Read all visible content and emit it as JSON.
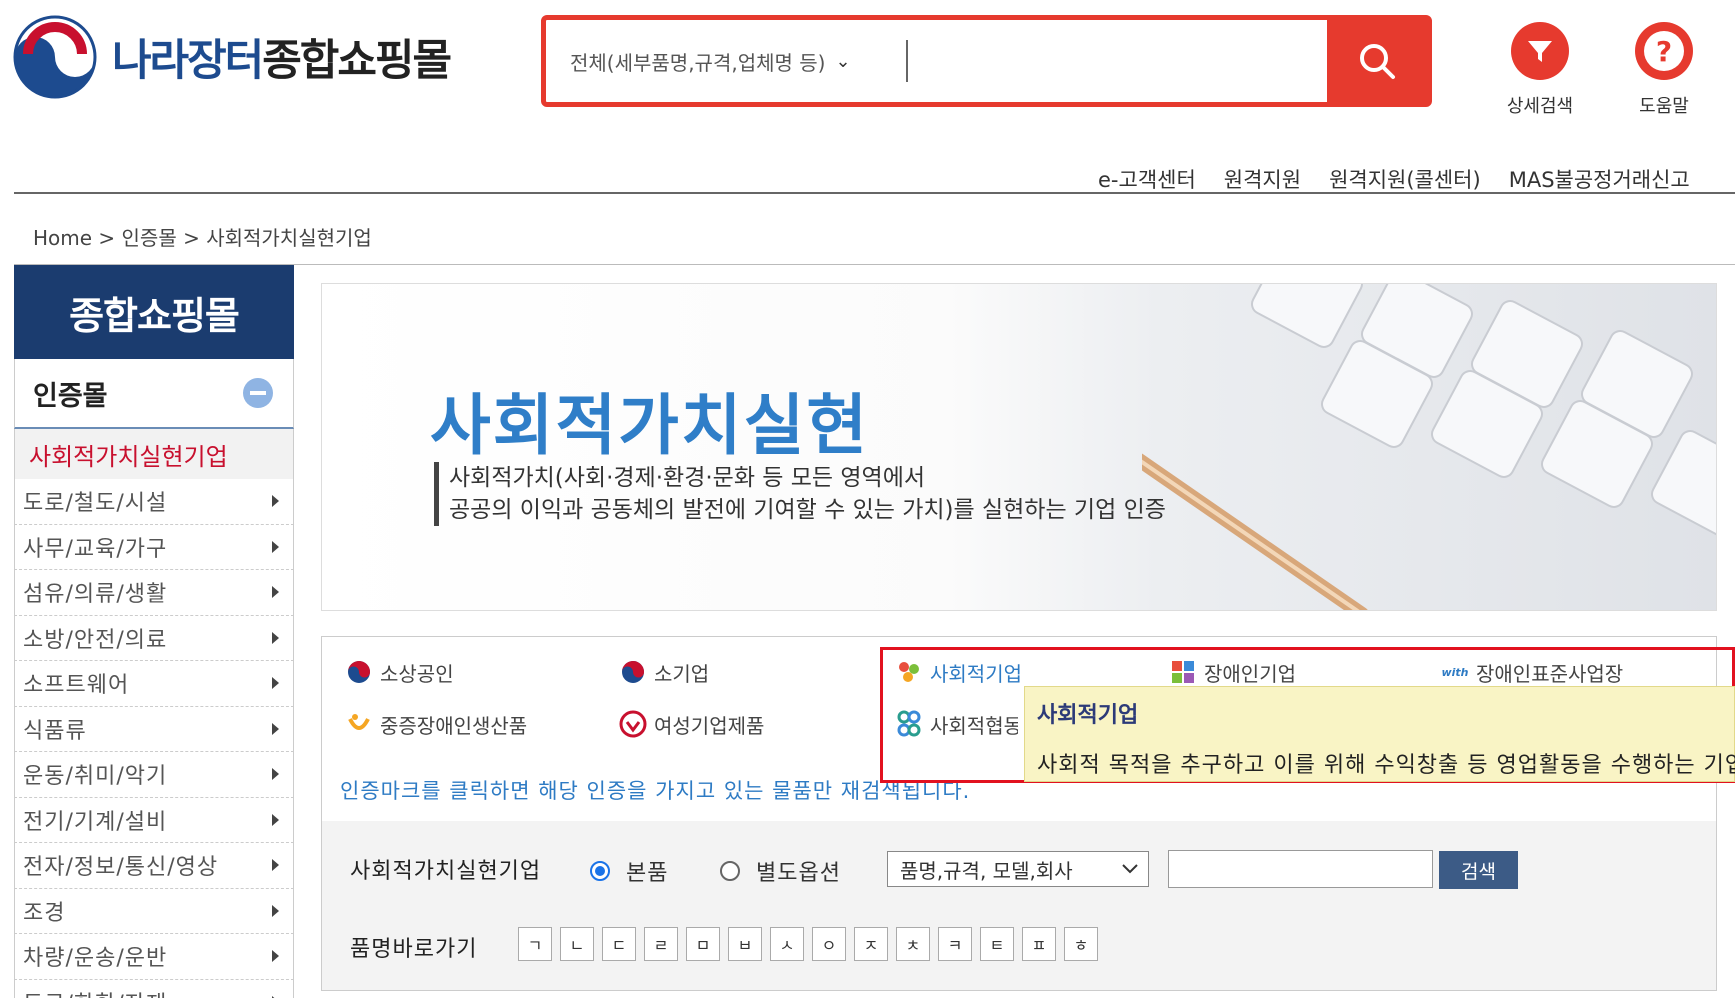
{
  "header": {
    "logo_blue": "나라장터",
    "logo_dark": "종합쇼핑몰",
    "search": {
      "scope": "전체(세부품명,규격,업체명 등)",
      "placeholder": ""
    },
    "tools": [
      {
        "label": "상세검색",
        "icon": "filter-icon"
      },
      {
        "label": "도움말",
        "icon": "help-icon"
      }
    ],
    "topnav": [
      "e-고객센터",
      "원격지원",
      "원격지원(콜센터)",
      "MAS불공정거래신고"
    ]
  },
  "breadcrumb": "Home > 인증몰 > 사회적가치실현기업",
  "sidebar": {
    "title": "종합쇼핑몰",
    "category": "인증몰",
    "active": "사회적가치실현기업",
    "items": [
      "도로/철도/시설",
      "사무/교육/가구",
      "섬유/의류/생활",
      "소방/안전/의료",
      "소프트웨어",
      "식품류",
      "운동/취미/악기",
      "전기/기계/설비",
      "전자/정보/통신/영상",
      "조경",
      "차량/운송/운반",
      "도료/화학/자재"
    ]
  },
  "banner": {
    "title": "사회적가치실현",
    "sub1": "사회적가치(사회·경제·환경·문화 등 모든 영역에서",
    "sub2": "공공의 이익과 공동체의 발전에 기여할 수 있는 가치)를 실현하는 기업 인증"
  },
  "certs": [
    "소상공인",
    "소기업",
    "사회적기업",
    "장애인기업",
    "장애인표준사업장",
    "중증장애인생산품",
    "여성기업제품",
    "사회적협동조합"
  ],
  "cert_note": "인증마크를 클릭하면 해당 인증을 가지고 있는 물품만 재검색됩니다.",
  "tooltip": {
    "title": "사회적기업",
    "text": "사회적 목적을 추구하고 이를 위해 수익창출 등 영업활동을 수행하는 기업"
  },
  "search_panel": {
    "label": "사회적가치실현기업",
    "radio1": "본품",
    "radio2": "별도옵션",
    "select": "품명,규격, 모델,회사",
    "button": "검색",
    "shortcut_label": "품명바로가기",
    "consonants": [
      "ㄱ",
      "ㄴ",
      "ㄷ",
      "ㄹ",
      "ㅁ",
      "ㅂ",
      "ㅅ",
      "ㅇ",
      "ㅈ",
      "ㅊ",
      "ㅋ",
      "ㅌ",
      "ㅍ",
      "ㅎ"
    ]
  },
  "colors": {
    "accent_red": "#e63a2e",
    "navy": "#1b3c6f",
    "link_blue": "#2e7bc4"
  }
}
